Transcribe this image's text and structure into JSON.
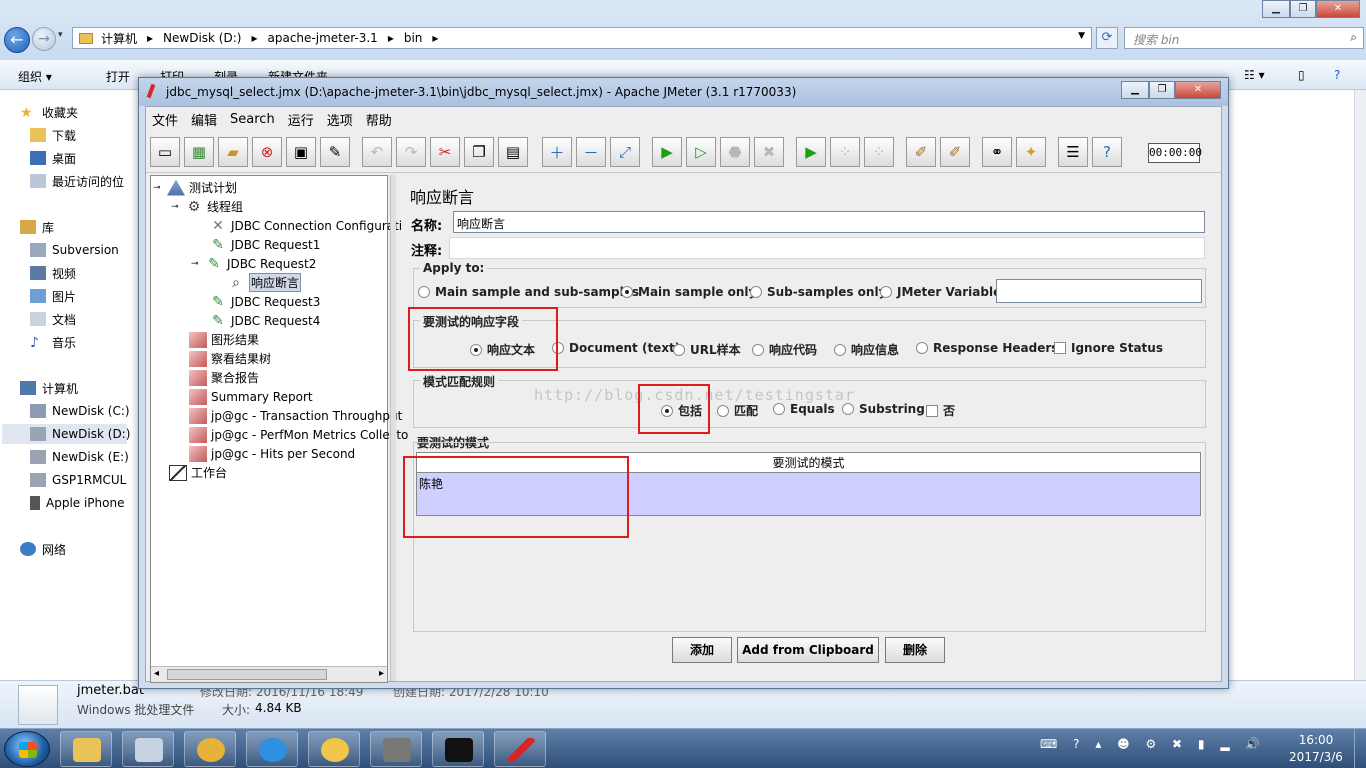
{
  "explorer": {
    "breadcrumb": [
      "计算机",
      "NewDisk (D:)",
      "apache-jmeter-3.1",
      "bin"
    ],
    "search_placeholder": "搜索 bin",
    "toolbar": [
      "组织 ▾",
      "打开",
      "打印",
      "刻录",
      "新建文件夹"
    ],
    "nav": {
      "favorites": "收藏夹",
      "downloads": "下载",
      "desktop": "桌面",
      "recent": "最近访问的位",
      "libraries": "库",
      "subversion": "Subversion",
      "videos": "视频",
      "pictures": "图片",
      "documents": "文档",
      "music": "音乐",
      "computer": "计算机",
      "drive_c": "NewDisk (C:)",
      "drive_d": "NewDisk (D:)",
      "drive_e": "NewDisk (E:)",
      "gsp": "GSP1RMCUL",
      "iphone": "Apple iPhone",
      "network": "网络"
    },
    "details": {
      "filename": "jmeter.bat",
      "modified": "修改日期: 2016/11/16 18:49",
      "created": "创建日期: 2017/2/28 10:10",
      "type": "Windows 批处理文件",
      "size_label": "大小:",
      "size": "4.84 KB"
    }
  },
  "taskbar": {
    "time": "16:00",
    "date": "2017/3/6"
  },
  "jmeter": {
    "title": "jdbc_mysql_select.jmx (D:\\apache-jmeter-3.1\\bin\\jdbc_mysql_select.jmx) - Apache JMeter (3.1 r1770033)",
    "menu": [
      "文件",
      "编辑",
      "Search",
      "运行",
      "选项",
      "帮助"
    ],
    "timer": "00:00:00",
    "tree": {
      "test_plan": "测试计划",
      "thread_group": "线程组",
      "jdbc_conn": "JDBC Connection Configurati",
      "jdbc_req1": "JDBC Request1",
      "jdbc_req2": "JDBC Request2",
      "assertion": "响应断言",
      "jdbc_req3": "JDBC Request3",
      "jdbc_req4": "JDBC Request4",
      "graph": "图形结果",
      "result_tree": "察看结果树",
      "aggregate": "聚合报告",
      "summary": "Summary Report",
      "throughput": "jp@gc - Transaction Throughput",
      "perfmon": "jp@gc - PerfMon Metrics Collecto",
      "hits": "jp@gc - Hits per Second",
      "workbench": "工作台"
    },
    "panel": {
      "heading": "响应断言",
      "name_label": "名称:",
      "name_value": "响应断言",
      "comment_label": "注释:",
      "comment_value": "",
      "apply_to": {
        "title": "Apply to:",
        "options": [
          "Main sample and sub-samples",
          "Main sample only",
          "Sub-samples only",
          "JMeter Variable"
        ],
        "selected": "Main sample only",
        "variable_value": ""
      },
      "field": {
        "title": "要测试的响应字段",
        "options": [
          "响应文本",
          "Document (text)",
          "URL样本",
          "响应代码",
          "响应信息",
          "Response Headers"
        ],
        "selected": "响应文本",
        "ignore_status": "Ignore Status"
      },
      "rules": {
        "title": "模式匹配规则",
        "options": [
          "包括",
          "匹配",
          "Equals",
          "Substring"
        ],
        "selected": "包括",
        "not_label": "否"
      },
      "patterns": {
        "title": "要测试的模式",
        "column": "要测试的模式",
        "rows": [
          "陈艳"
        ]
      },
      "buttons": {
        "add": "添加",
        "clipboard": "Add from Clipboard",
        "delete": "删除"
      },
      "watermark": "http://blog.csdn.net/testingstar"
    }
  }
}
